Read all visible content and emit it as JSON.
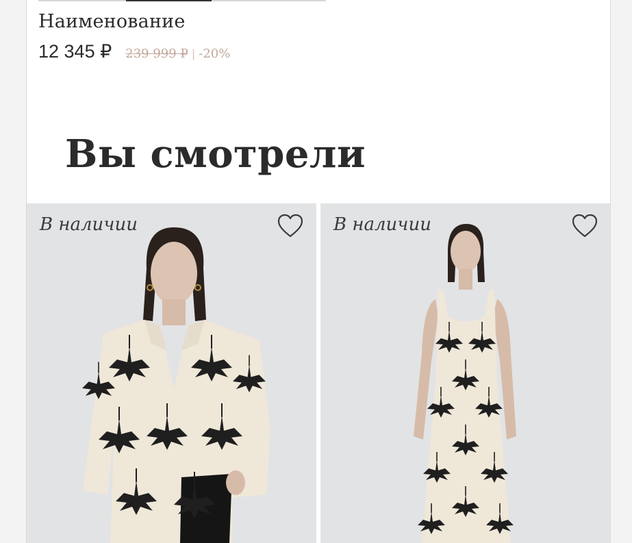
{
  "product": {
    "name": "Наименование",
    "price": "12 345 ₽",
    "old_price": "239 999 ₽",
    "separator": "|",
    "discount": "-20%"
  },
  "section": {
    "title": "Вы смотрели"
  },
  "cards": [
    {
      "stock_label": "В наличии",
      "icon": "heart-icon"
    },
    {
      "stock_label": "В наличии",
      "icon": "heart-icon"
    }
  ],
  "colors": {
    "text": "#2b2b2b",
    "old_price": "#c3a89c",
    "card_background": "#e2e3e5",
    "garment": "#efe7d8",
    "print": "#1f1f1f"
  }
}
